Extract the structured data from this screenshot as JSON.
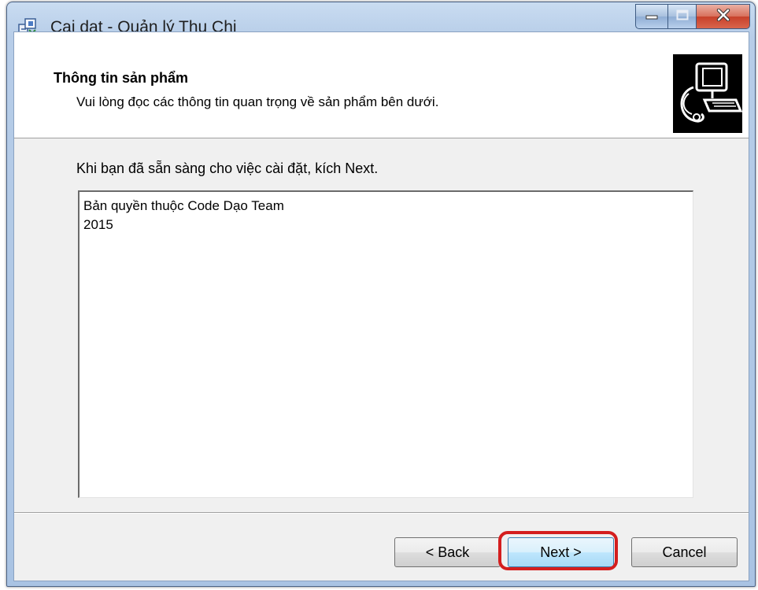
{
  "window": {
    "title": "Cai dat - Quản lý Thu Chi",
    "controls": {
      "minimize_icon": "minimize-icon",
      "maximize_icon": "maximize-icon",
      "close_icon": "close-icon"
    }
  },
  "header": {
    "title": "Thông tin sản phẩm",
    "subtitle": "Vui lòng đọc các thông tin quan trọng về sản phẩm bên dưới."
  },
  "body": {
    "instruction": "Khi bạn đã sẵn sàng cho việc cài đặt, kích Next.",
    "info_lines": [
      "Bản quyền thuộc Code Dạo Team",
      "2015"
    ]
  },
  "buttons": {
    "back": "< Back",
    "next": "Next >",
    "cancel": "Cancel"
  },
  "colors": {
    "highlight": "#d41e1e",
    "title_bar": "#b7cde8",
    "close_button": "#c7402a"
  }
}
